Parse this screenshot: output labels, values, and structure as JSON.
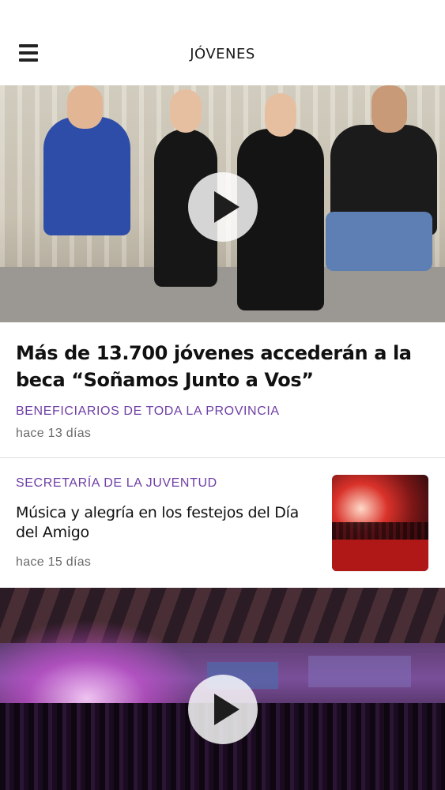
{
  "header": {
    "title": "JÓVENES",
    "menu_icon": "hamburger-menu-icon"
  },
  "featured": {
    "title": "Más de 13.700 jóvenes accederán a la beca “Soñamos Junto a Vos”",
    "category": "BENEFICIARIOS DE TODA LA PROVINCIA",
    "time": "hace 13 días",
    "media_icon": "play-icon"
  },
  "article": {
    "category": "SECRETARÍA DE LA JUVENTUD",
    "title": "Música y alegría en los festejos del Día del Amigo",
    "time": "hace 15 días"
  },
  "video": {
    "media_icon": "play-icon"
  },
  "colors": {
    "category_accent": "#6e3ea6",
    "timestamp": "#6a6a6a",
    "divider": "#dcdcdc"
  }
}
